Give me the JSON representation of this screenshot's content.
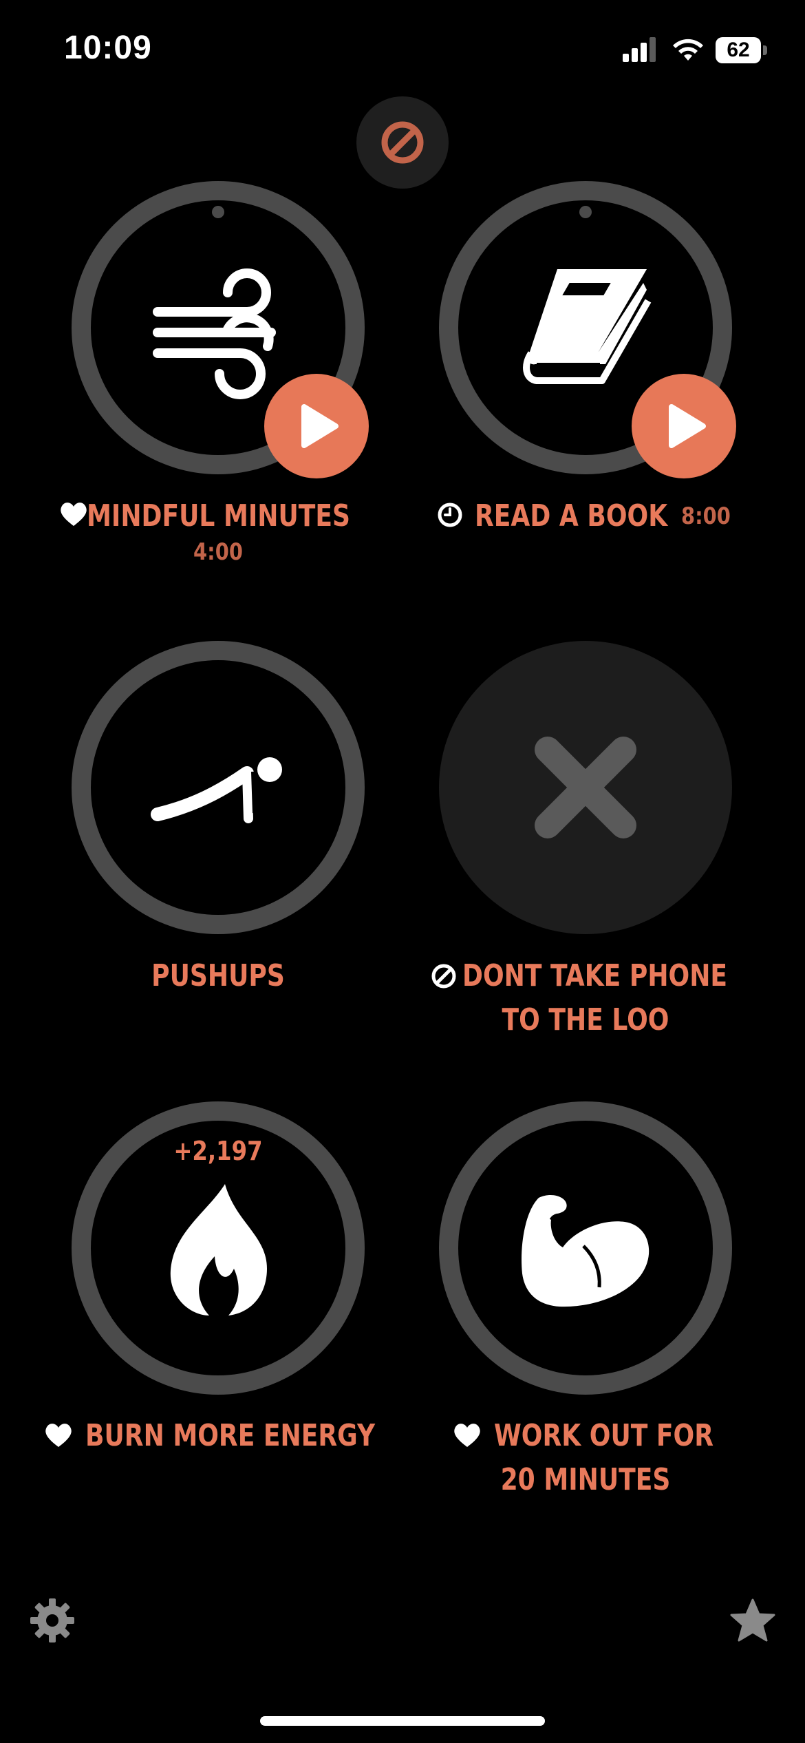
{
  "status_bar": {
    "time": "10:09",
    "battery": "62"
  },
  "colors": {
    "accent": "#e87a5b",
    "ring": "#4b4b4b",
    "background": "#000000"
  },
  "top_action": {
    "icon": "prohibited-icon"
  },
  "habits": [
    {
      "label": "MINDFUL MINUTES",
      "detail": "4:00",
      "type_icon": "heart-icon",
      "icon": "wind-icon",
      "has_play": true
    },
    {
      "label": "READ A BOOK",
      "detail": "8:00",
      "type_icon": "clock-icon",
      "icon": "book-icon",
      "has_play": true
    },
    {
      "label": "PUSHUPS",
      "type_icon": "",
      "icon": "pushup-icon",
      "has_play": false
    },
    {
      "label_line1": "DONT TAKE PHONE",
      "label_line2": "TO THE LOO",
      "type_icon": "prohibited-icon",
      "icon": "x-icon",
      "has_play": false
    },
    {
      "label": "BURN MORE ENERGY",
      "stat": "+2,197",
      "type_icon": "heart-icon",
      "icon": "flame-icon",
      "has_play": false
    },
    {
      "label_line1": "WORK OUT FOR",
      "label_line2": "20 MINUTES",
      "type_icon": "heart-icon",
      "icon": "flexed-biceps-icon",
      "has_play": false
    }
  ],
  "bottom_bar": {
    "left_icon": "gear-icon",
    "right_icon": "star-icon"
  }
}
